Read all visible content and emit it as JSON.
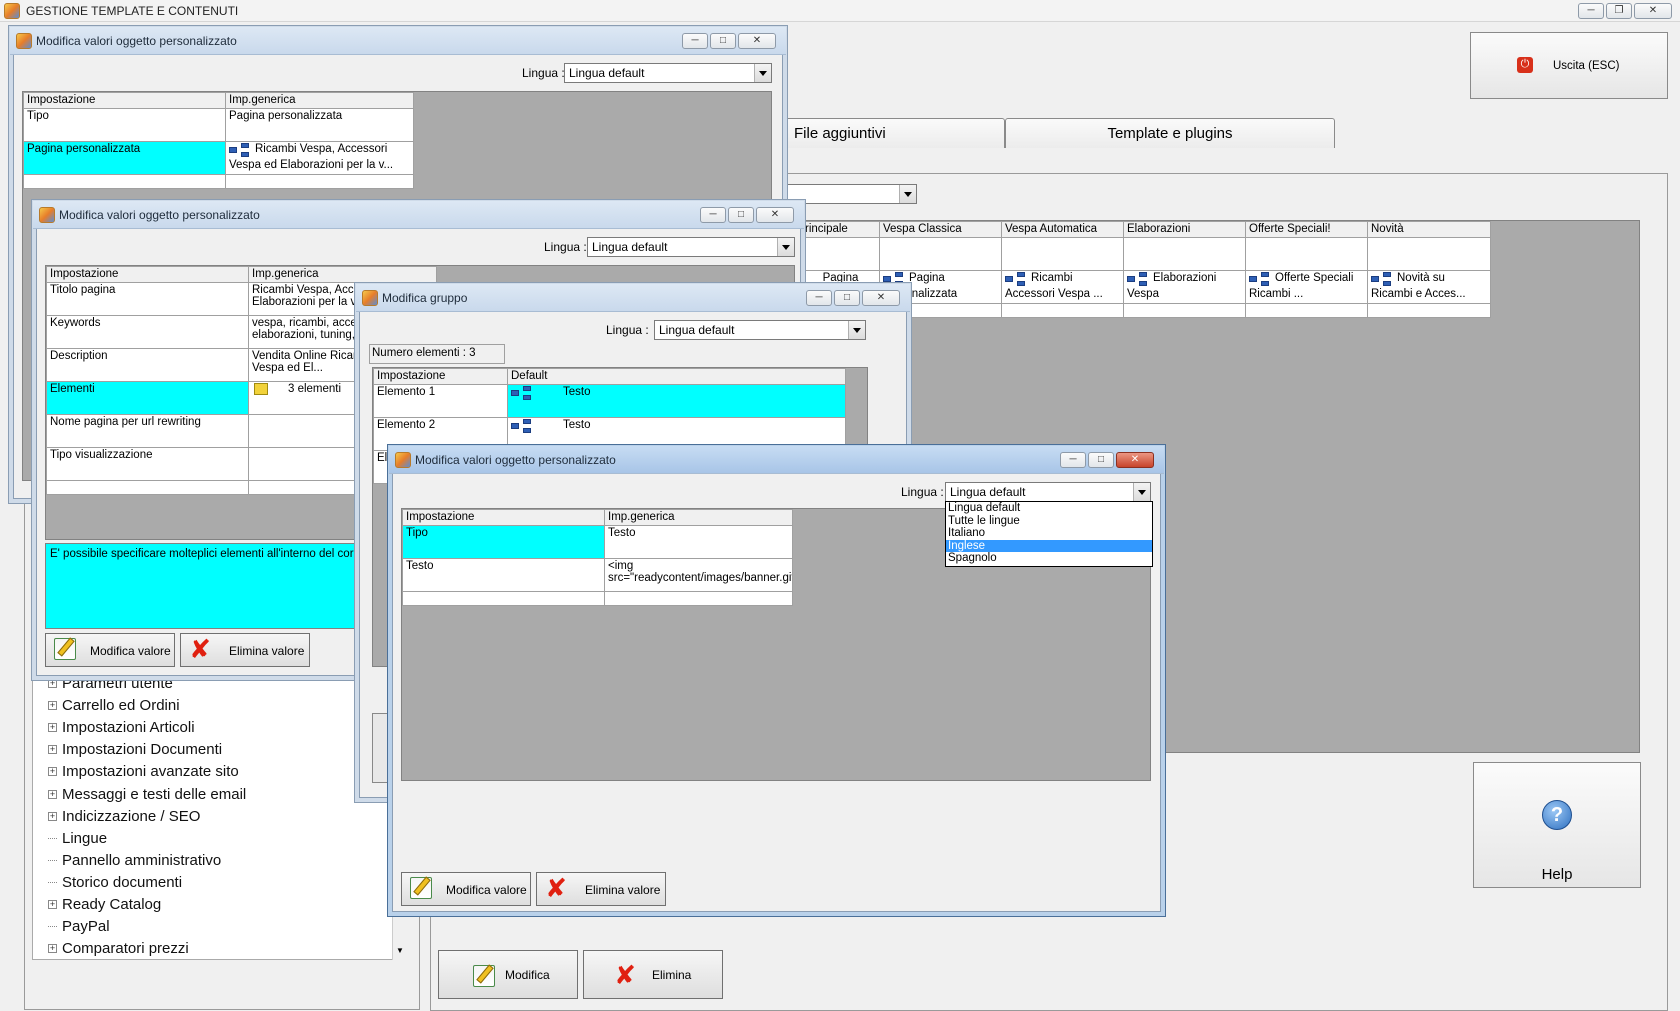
{
  "main_window": {
    "title": "GESTIONE TEMPLATE E CONTENUTI"
  },
  "exit_button": {
    "label": "Uscita (ESC)"
  },
  "tabs": [
    {
      "label": "File aggiuntivi"
    },
    {
      "label": "Template e plugins"
    }
  ],
  "bg_grid": {
    "headers": [
      "rincipale",
      "Vespa Classica",
      "Vespa Automatica",
      "Elaborazioni",
      "Offerte Speciali!",
      "Novità"
    ],
    "cells": [
      "Pagina",
      "Pagina personalizzata",
      "Ricambi Accessori Vespa ...",
      "Elaborazioni Vespa",
      "Offerte Speciali Ricambi ...",
      "Novità su Ricambi e Acces..."
    ]
  },
  "tree_items": [
    {
      "label": "Parametri utente",
      "expandable": true
    },
    {
      "label": "Carrello ed Ordini",
      "expandable": true
    },
    {
      "label": "Impostazioni Articoli",
      "expandable": true
    },
    {
      "label": "Impostazioni Documenti",
      "expandable": true
    },
    {
      "label": "Impostazioni avanzate sito",
      "expandable": true
    },
    {
      "label": "Messaggi e testi delle email",
      "expandable": true
    },
    {
      "label": "Indicizzazione / SEO",
      "expandable": true
    },
    {
      "label": "Lingue",
      "expandable": false
    },
    {
      "label": "Pannello amministrativo",
      "expandable": false
    },
    {
      "label": "Storico documenti",
      "expandable": false
    },
    {
      "label": "Ready Catalog",
      "expandable": true
    },
    {
      "label": "PayPal",
      "expandable": false
    },
    {
      "label": "Comparatori prezzi",
      "expandable": true
    }
  ],
  "bottom_buttons": {
    "modifica": "Modifica",
    "elimina": "Elimina"
  },
  "help_button": {
    "label": "Help"
  },
  "dlg1": {
    "title": "Modifica valori oggetto personalizzato",
    "lingua_label": "Lingua :",
    "lingua_value": "Lingua default",
    "headers": [
      "Impostazione",
      "Imp.generica"
    ],
    "rows": [
      {
        "k": "Tipo",
        "v": "Pagina personalizzata"
      },
      {
        "k": "Pagina personalizzata",
        "v": "Ricambi Vespa, Accessori Vespa ed Elaborazioni per la v..."
      }
    ]
  },
  "dlg2": {
    "title": "Modifica valori oggetto personalizzato",
    "lingua_label": "Lingua :",
    "lingua_value": "Lingua default",
    "headers": [
      "Impostazione",
      "Imp.generica"
    ],
    "rows": [
      {
        "k": "Titolo pagina",
        "v": "Ricambi Vespa, Acces... Elaborazioni per la ves..."
      },
      {
        "k": "Keywords",
        "v": "vespa, ricambi, access... elaborazioni, tuning, pe..."
      },
      {
        "k": "Description",
        "v": "Vendita  Online Ricam... Accessori Vespa ed El..."
      },
      {
        "k": "Elementi",
        "v": "3 elementi"
      },
      {
        "k": "Nome pagina per url rewriting",
        "v": ""
      },
      {
        "k": "Tipo visualizzazione",
        "v": ""
      }
    ],
    "info_text": "E' possibile specificare molteplici elementi all'interno del corpo pag...",
    "btn_modifica": "Modifica valore",
    "btn_elimina": "Elimina valore"
  },
  "dlg3": {
    "title": "Modifica gruppo",
    "lingua_label": "Lingua :",
    "lingua_value": "Lingua default",
    "count_label": "Numero elementi : 3",
    "headers": [
      "Impostazione",
      "Default"
    ],
    "rows": [
      {
        "k": "Elemento 1",
        "v": "Testo"
      },
      {
        "k": "Elemento 2",
        "v": "Testo"
      },
      {
        "k": "Ele",
        "v": ""
      }
    ]
  },
  "dlg4": {
    "title": "Modifica valori oggetto personalizzato",
    "lingua_label": "Lingua :",
    "lingua_value": "Lingua default",
    "headers": [
      "Impostazione",
      "Imp.generica"
    ],
    "rows": [
      {
        "k": "Tipo",
        "v": "Testo"
      },
      {
        "k": "Testo",
        "v": "<img src=\"readycontent/images/banner.gif"
      }
    ],
    "dropdown_options": [
      "Lingua default",
      "Tutte le lingue",
      "Italiano",
      "Inglese",
      "Spagnolo"
    ],
    "dropdown_selected": 3,
    "btn_modifica": "Modifica valore",
    "btn_elimina": "Elimina valore"
  },
  "colors": {
    "highlight": "#00ffff",
    "selection": "#3399ff",
    "grid_bg": "#aaaaaa"
  }
}
